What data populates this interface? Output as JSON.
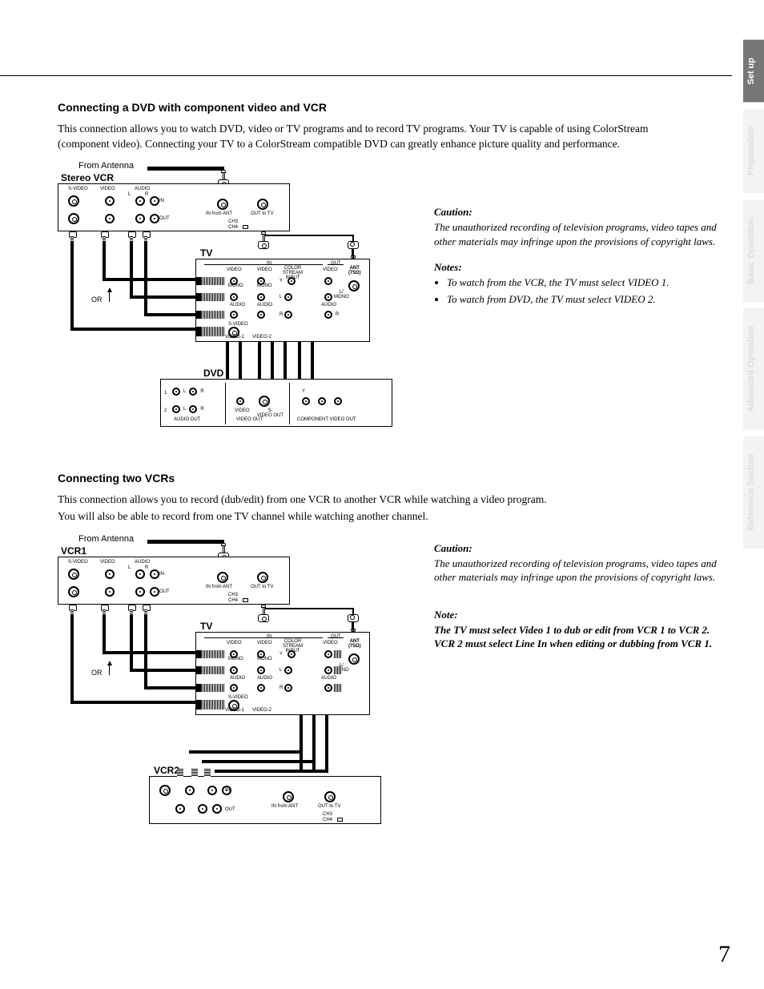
{
  "page_number": "7",
  "tabs": [
    "Set up",
    "Preparation",
    "Basic Operation",
    "Advanced Operation",
    "Reference Section"
  ],
  "section1": {
    "title": "Connecting a DVD with component video and VCR",
    "body": "This connection allows you to watch DVD, video or TV programs and to record TV programs. Your TV is capable of using ColorStream (component video). Connecting your TV to a ColorStream compatible DVD can greatly enhance picture quality and performance.",
    "from_antenna": "From Antenna",
    "vcr_label": "Stereo VCR",
    "tv_label": "TV",
    "dvd_label": "DVD",
    "or_label": "OR",
    "caution_h": "Caution:",
    "caution_body": "The unauthorized recording of television programs, video tapes and other materials may infringe upon the provisions of copyright laws.",
    "notes_h": "Notes:",
    "notes": [
      "To watch from the VCR, the TV must select VIDEO 1.",
      "To watch from DVD, the TV must select VIDEO 2."
    ],
    "labels": {
      "svideo": "S-VIDEO",
      "video": "VIDEO",
      "audio": "AUDIO",
      "l": "L",
      "r": "R",
      "in": "IN",
      "out": "OUT",
      "in_from_ant": "IN from ANT",
      "out_to_tv": "OUT to TV",
      "ch3": "CH3",
      "ch4": "CH4",
      "color_stream": "COLOR\nSTREAM\nINPUT",
      "ant": "ANT\n(75Ω)",
      "mono": "MONO",
      "y": "Y",
      "lmono": "L/\nMONO",
      "video1": "VIDEO-1",
      "video2": "VIDEO-2",
      "audio_out": "AUDIO OUT",
      "video_out": "VIDEO OUT",
      "svideo_out": "S-\nVIDEO OUT",
      "comp_out": "COMPONENT VIDEO OUT",
      "one": "1",
      "two": "2"
    }
  },
  "section2": {
    "title": "Connecting two VCRs",
    "body1": "This connection allows you to record (dub/edit) from one VCR to another VCR while watching a video program.",
    "body2": "You will also be able to record from one TV channel while watching another channel.",
    "from_antenna": "From Antenna",
    "vcr1_label": "VCR1",
    "vcr2_label": "VCR2",
    "tv_label": "TV",
    "or_label": "OR",
    "caution_h": "Caution:",
    "caution_body": "The unauthorized recording of television programs, video tapes and other materials may infringe upon the provisions of copyright laws.",
    "note_h": "Note:",
    "note_body": "The TV must select Video 1 to dub or edit from VCR 1 to VCR 2.  VCR 2 must select Line In when editing or dubbing from VCR 1.",
    "labels": {
      "svideo": "S-VIDEO",
      "video": "VIDEO",
      "audio": "AUDIO",
      "l": "L",
      "r": "R",
      "in": "IN",
      "out": "OUT",
      "in_from_ant": "IN from ANT",
      "out_to_tv": "OUT to TV",
      "ch3": "CH3",
      "ch4": "CH4",
      "color_stream": "COLOR\nSTREAM\nINPUT",
      "ant": "ANT\n(75Ω)",
      "mono": "MONO",
      "y": "Y",
      "lmono": "L/\nMONO",
      "video1": "VIDEO-1",
      "video2": "VIDEO-2"
    }
  }
}
